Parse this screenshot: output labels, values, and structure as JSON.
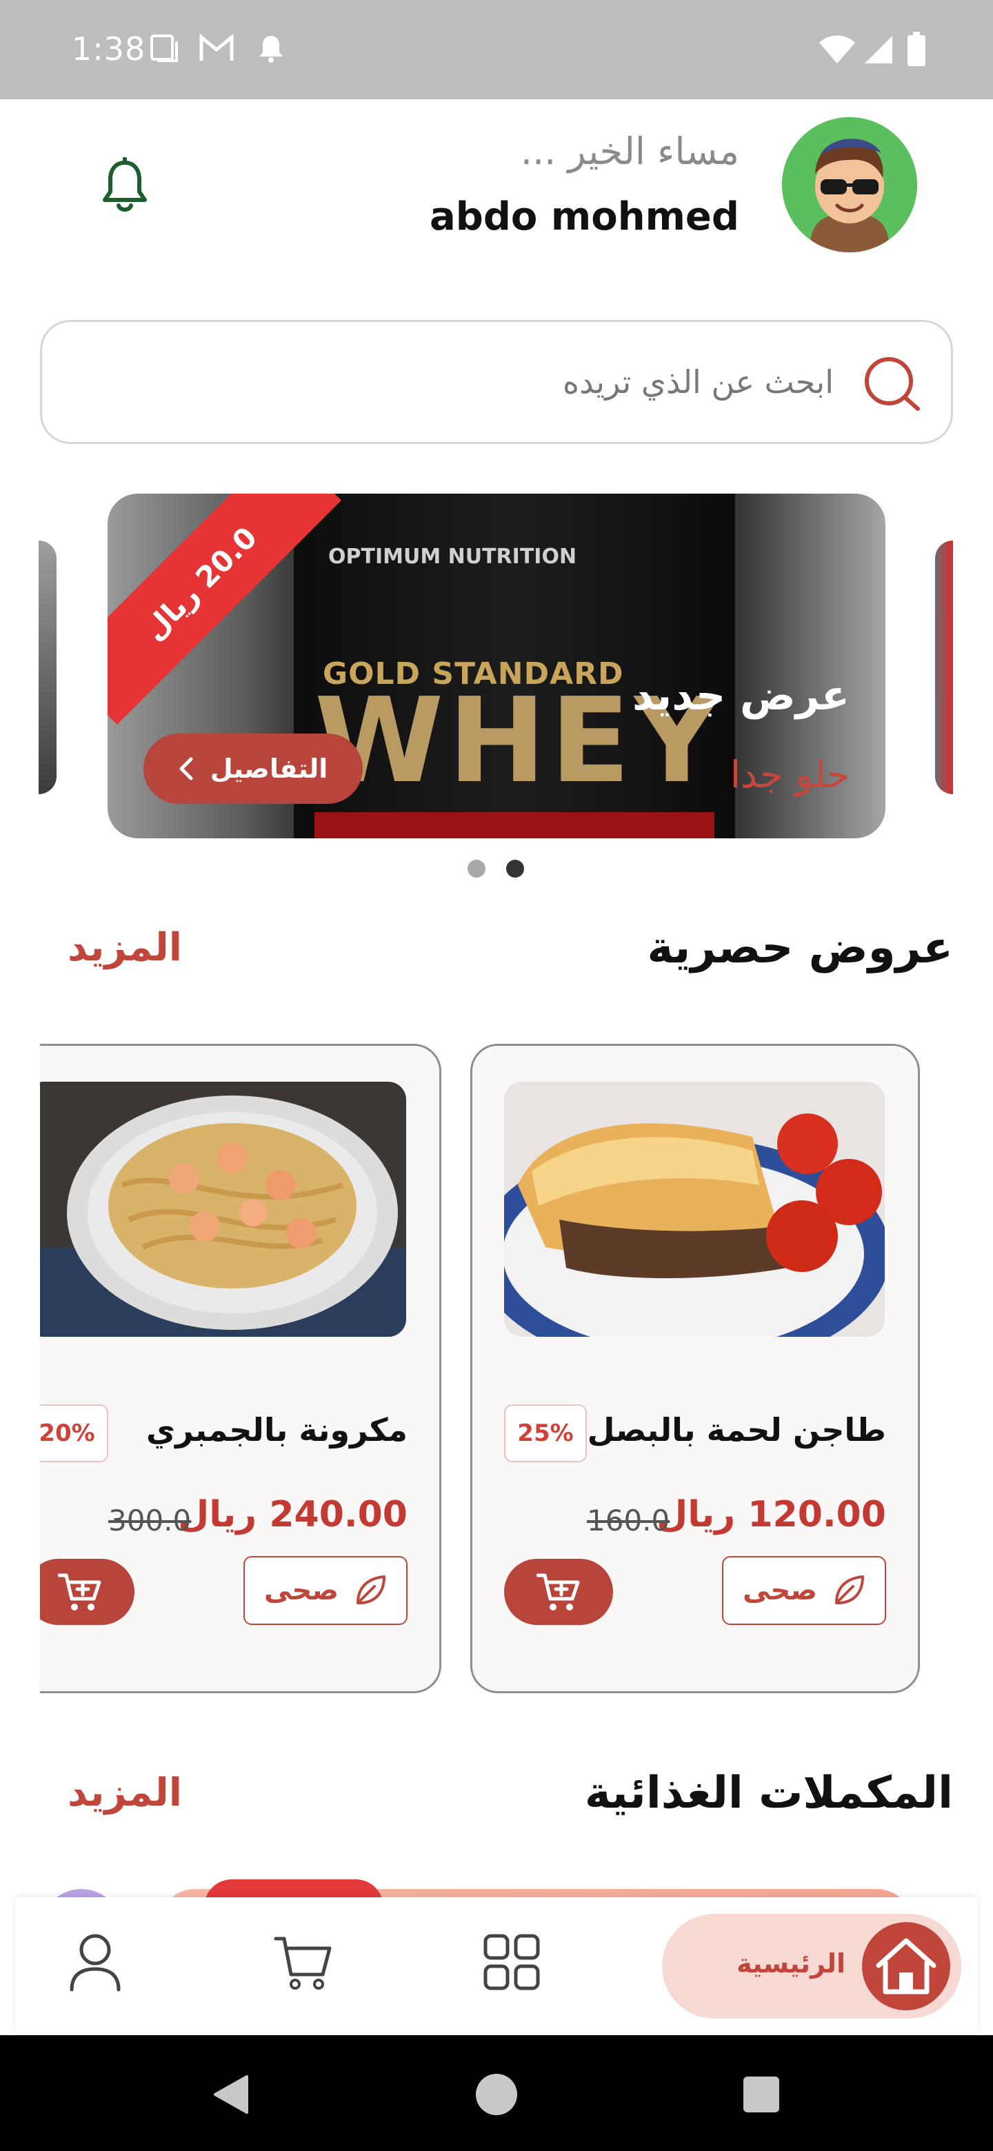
{
  "status_bar": {
    "time": "1:38",
    "icons": [
      "screenshot-icon",
      "gmail-icon",
      "notification-icon",
      "wifi-icon",
      "signal-icon",
      "battery-icon"
    ]
  },
  "header": {
    "greeting": "مساء الخير ...",
    "username": "abdo mohmed",
    "icons": [
      "avatar",
      "bell-icon"
    ]
  },
  "search": {
    "placeholder": "ابحث عن الذي تريده"
  },
  "banner": {
    "badge": "20.0 ريال",
    "title": "عرض جديد",
    "subtitle": "حلو جدا",
    "details_label": "التفاصيل",
    "product_brand": "OPTIMUM NUTRITION",
    "product_line": "GOLD STANDARD",
    "product_name": "WHEY",
    "active_dot": 2,
    "dot_count": 2
  },
  "offers": {
    "title": "عروض حصرية",
    "more": "المزيد",
    "items": [
      {
        "name": "طاجن لحمة بالبصل",
        "discount": "25%",
        "price": "120.00 ريال",
        "old_price": "160.0",
        "tag": "صحى"
      },
      {
        "name": "مكرونة بالجمبري",
        "discount": "20%",
        "price": "240.00 ريال",
        "old_price": "300.0",
        "tag": "صحى"
      }
    ]
  },
  "supplements": {
    "title": "المكملات الغذائية",
    "more": "المزيد"
  },
  "bottom_nav": {
    "home_label": "الرئيسية",
    "items": [
      "home-icon",
      "grid-icon",
      "cart-icon",
      "profile-icon"
    ]
  },
  "colors": {
    "accent": "#c0463c",
    "price": "#c33a32",
    "badge_red": "#e63434",
    "home_pill": "#f7d9d4",
    "status_bar": "#bdbdbd"
  }
}
